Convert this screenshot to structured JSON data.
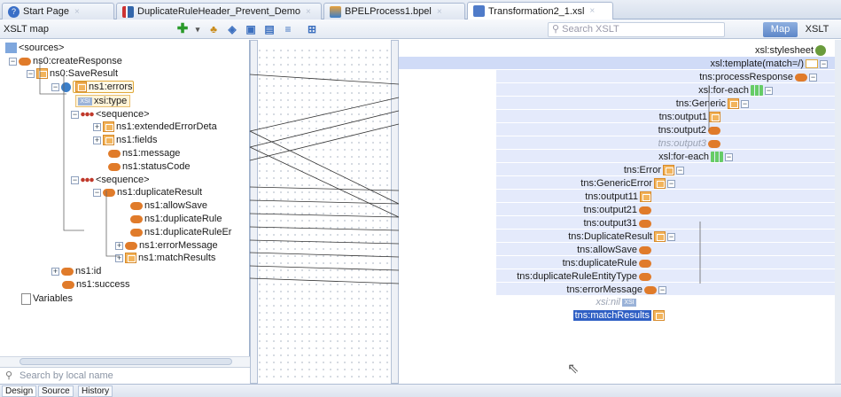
{
  "tabs": [
    {
      "label": "Start Page",
      "icon": "help-icon"
    },
    {
      "label": "DuplicateRuleHeader_Prevent_Demo",
      "icon": "composite-icon"
    },
    {
      "label": "BPELProcess1.bpel",
      "icon": "bpel-icon"
    },
    {
      "label": "Transformation2_1.xsl",
      "icon": "xsl-icon",
      "active": true
    }
  ],
  "toolbar": {
    "mode_select": "XSLT map",
    "search_placeholder": "Search XSLT",
    "map_label": "Map",
    "xslt_label": "XSLT",
    "icons": [
      "add-icon",
      "dropdown-icon",
      "function-icon",
      "graph-icon",
      "group-icon",
      "variable-icon",
      "list-icon",
      "search-tree-icon"
    ]
  },
  "source": {
    "root": "<sources>",
    "items": [
      {
        "label": "ns0:createResponse"
      },
      {
        "label": "ns0:SaveResult"
      },
      {
        "label": "ns1:errors"
      },
      {
        "label": "xsi:type",
        "badge": "xsi"
      },
      {
        "label": "<sequence>"
      },
      {
        "label": "ns1:extendedErrorDeta"
      },
      {
        "label": "ns1:fields"
      },
      {
        "label": "ns1:message"
      },
      {
        "label": "ns1:statusCode"
      },
      {
        "label": "<sequence>"
      },
      {
        "label": "ns1:duplicateResult"
      },
      {
        "label": "ns1:allowSave"
      },
      {
        "label": "ns1:duplicateRule"
      },
      {
        "label": "ns1:duplicateRuleEr"
      },
      {
        "label": "ns1:errorMessage"
      },
      {
        "label": "ns1:matchResults"
      },
      {
        "label": "ns1:id"
      },
      {
        "label": "ns1:success"
      },
      {
        "label": "Variables"
      }
    ],
    "search_placeholder": "Search by local name"
  },
  "target": {
    "items": [
      {
        "label": "xsl:stylesheet"
      },
      {
        "label": "xsl:template(match=/)"
      },
      {
        "label": "tns:processResponse"
      },
      {
        "label": "xsl:for-each"
      },
      {
        "label": "tns:Generic"
      },
      {
        "label": "tns:output1"
      },
      {
        "label": "tns:output2"
      },
      {
        "label": "tns:output3"
      },
      {
        "label": "xsl:for-each"
      },
      {
        "label": "tns:Error"
      },
      {
        "label": "tns:GenericError"
      },
      {
        "label": "tns:output11"
      },
      {
        "label": "tns:output21"
      },
      {
        "label": "tns:output31"
      },
      {
        "label": "tns:DuplicateResult"
      },
      {
        "label": "tns:allowSave"
      },
      {
        "label": "tns:duplicateRule"
      },
      {
        "label": "tns:duplicateRuleEntityType"
      },
      {
        "label": "tns:errorMessage"
      },
      {
        "label": "xsi:nil"
      },
      {
        "label": "tns:matchResults"
      }
    ]
  },
  "bottom_tabs": [
    "Design",
    "Source",
    "History"
  ],
  "colors": {
    "accent": "#2f5fc4",
    "element": "#e07b2a",
    "band": "#e4eafb"
  }
}
